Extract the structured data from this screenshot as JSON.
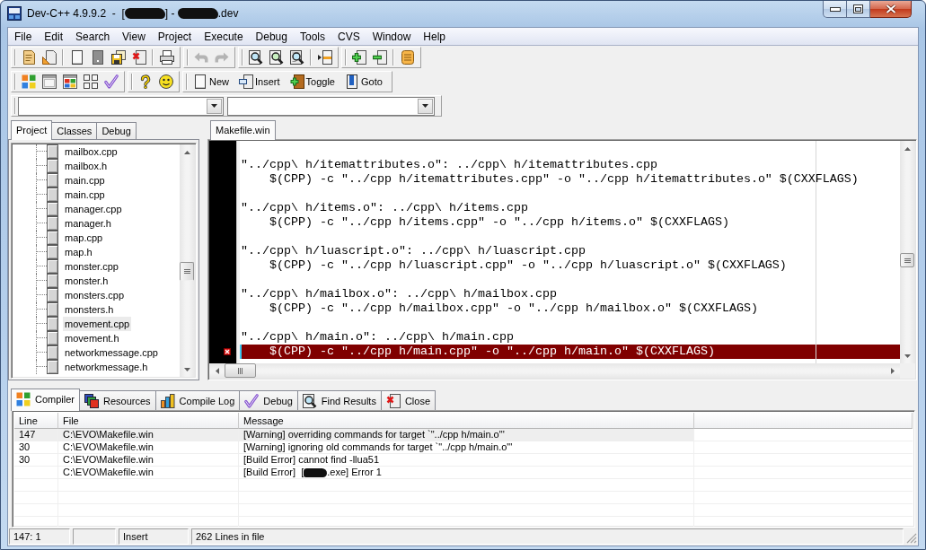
{
  "window": {
    "title": [
      {
        "kind": "text",
        "text": "Dev-C++ 4.9.9.2  -  ["
      },
      {
        "kind": "redacted"
      },
      {
        "kind": "text",
        "text": "] - "
      },
      {
        "kind": "redacted"
      },
      {
        "kind": "text",
        "text": ".dev"
      }
    ]
  },
  "menu": [
    "File",
    "Edit",
    "Search",
    "View",
    "Project",
    "Execute",
    "Debug",
    "Tools",
    "CVS",
    "Window",
    "Help"
  ],
  "toolbars": [
    {
      "groups": [
        {
          "sections": [
            {
              "buttons": [
                {
                  "kind": "project",
                  "disabled": false
                },
                {
                  "kind": "open",
                  "disabled": false
                }
              ]
            },
            {
              "buttons": [
                {
                  "kind": "new",
                  "disabled": false
                },
                {
                  "kind": "blank",
                  "disabled": false
                },
                {
                  "kind": "saveall",
                  "disabled": false
                },
                {
                  "kind": "close",
                  "disabled": false
                }
              ]
            },
            {
              "buttons": [
                {
                  "kind": "print",
                  "disabled": false
                }
              ]
            }
          ]
        },
        {
          "sections": [
            {
              "buttons": [
                {
                  "kind": "undo",
                  "disabled": true
                },
                {
                  "kind": "redo",
                  "disabled": true
                }
              ]
            }
          ]
        },
        {
          "sections": [
            {
              "buttons": [
                {
                  "kind": "find",
                  "disabled": false
                },
                {
                  "kind": "findnext",
                  "disabled": false
                },
                {
                  "kind": "replace",
                  "disabled": false
                }
              ]
            },
            {
              "buttons": [
                {
                  "kind": "gotoline",
                  "disabled": false
                }
              ]
            }
          ]
        },
        {
          "sections": [
            {
              "buttons": [
                {
                  "kind": "add",
                  "disabled": false
                },
                {
                  "kind": "remove",
                  "disabled": false
                }
              ]
            },
            {
              "buttons": [
                {
                  "kind": "note",
                  "disabled": false
                }
              ]
            }
          ]
        }
      ]
    },
    {
      "groups": [
        {
          "sections": [
            {
              "buttons": [
                {
                  "kind": "tiles",
                  "disabled": false
                },
                {
                  "kind": "window",
                  "disabled": false
                },
                {
                  "kind": "colorgrid",
                  "disabled": false
                },
                {
                  "kind": "grid",
                  "disabled": false
                },
                {
                  "kind": "check",
                  "disabled": false
                }
              ]
            }
          ]
        },
        {
          "sections": [
            {
              "buttons": [
                {
                  "kind": "help",
                  "disabled": false
                },
                {
                  "kind": "smiley",
                  "disabled": false
                }
              ]
            }
          ]
        },
        {
          "sections": [
            {
              "buttons": [
                {
                  "kind": "new",
                  "label": "New",
                  "disabled": false
                },
                {
                  "kind": "insert",
                  "label": "Insert",
                  "disabled": false
                },
                {
                  "kind": "toggle",
                  "label": "Toggle",
                  "disabled": false
                },
                {
                  "kind": "goto",
                  "label": "Goto",
                  "disabled": false
                }
              ]
            }
          ]
        }
      ]
    }
  ],
  "left_tabs": [
    {
      "label": "Project",
      "selected": true
    },
    {
      "label": "Classes",
      "selected": false
    },
    {
      "label": "Debug",
      "selected": false
    }
  ],
  "project_tree": {
    "items": [
      {
        "label": "mailbox.cpp",
        "selected": false
      },
      {
        "label": "mailbox.h",
        "selected": false
      },
      {
        "label": "main.cpp",
        "selected": false
      },
      {
        "label": "main.cpp",
        "selected": false
      },
      {
        "label": "manager.cpp",
        "selected": false
      },
      {
        "label": "manager.h",
        "selected": false
      },
      {
        "label": "map.cpp",
        "selected": false
      },
      {
        "label": "map.h",
        "selected": false
      },
      {
        "label": "monster.cpp",
        "selected": false
      },
      {
        "label": "monster.h",
        "selected": false
      },
      {
        "label": "monsters.cpp",
        "selected": false
      },
      {
        "label": "monsters.h",
        "selected": false
      },
      {
        "label": "movement.cpp",
        "selected": true
      },
      {
        "label": "movement.h",
        "selected": false
      },
      {
        "label": "networkmessage.cpp",
        "selected": false
      },
      {
        "label": "networkmessage.h",
        "selected": false
      }
    ]
  },
  "editor": {
    "tabs": [
      {
        "label": "Makefile.win",
        "selected": true
      }
    ],
    "rules": [
      {
        "target": "\"../cpp\\ h/itemattributes.o\": ../cpp\\ h/itemattributes.cpp",
        "command": "$(CPP) -c \"../cpp h/itemattributes.cpp\" -o \"../cpp h/itemattributes.o\" $(CXXFLAGS)",
        "error": false
      },
      {
        "target": "\"../cpp\\ h/items.o\": ../cpp\\ h/items.cpp",
        "command": "$(CPP) -c \"../cpp h/items.cpp\" -o \"../cpp h/items.o\" $(CXXFLAGS)",
        "error": false
      },
      {
        "target": "\"../cpp\\ h/luascript.o\": ../cpp\\ h/luascript.cpp",
        "command": "$(CPP) -c \"../cpp h/luascript.cpp\" -o \"../cpp h/luascript.o\" $(CXXFLAGS)",
        "error": false
      },
      {
        "target": "\"../cpp\\ h/mailbox.o\": ../cpp\\ h/mailbox.cpp",
        "command": "$(CPP) -c \"../cpp h/mailbox.cpp\" -o \"../cpp h/mailbox.o\" $(CXXFLAGS)",
        "error": false
      },
      {
        "target": "\"../cpp\\ h/main.o\": ../cpp\\ h/main.cpp",
        "command": "$(CPP) -c \"../cpp h/main.cpp\" -o \"../cpp h/main.o\" $(CXXFLAGS)",
        "error": true
      }
    ]
  },
  "bottom_tabs": [
    {
      "label": "Compiler",
      "kind": "compiler",
      "selected": true
    },
    {
      "label": "Resources",
      "kind": "resources",
      "selected": false
    },
    {
      "label": "Compile Log",
      "kind": "log",
      "selected": false
    },
    {
      "label": "Debug",
      "kind": "debug",
      "selected": false
    },
    {
      "label": "Find Results",
      "kind": "find",
      "selected": false
    },
    {
      "label": "Close",
      "kind": "close",
      "selected": false
    }
  ],
  "compiler_table": {
    "columns": [
      "Line",
      "File",
      "Message"
    ],
    "rows": [
      {
        "line": "147",
        "file": "C:\\EVO\\Makefile.win",
        "message": [
          {
            "kind": "text",
            "text": "[Warning] overriding commands for target `\"../cpp h/main.o\"'"
          }
        ],
        "selected": true
      },
      {
        "line": "30",
        "file": "C:\\EVO\\Makefile.win",
        "message": [
          {
            "kind": "text",
            "text": "[Warning] ignoring old commands for target `\"../cpp h/main.o\"'"
          }
        ],
        "selected": false
      },
      {
        "line": "30",
        "file": "C:\\EVO\\Makefile.win",
        "message": [
          {
            "kind": "text",
            "text": "[Build Error] cannot find -llua51"
          }
        ],
        "selected": false
      },
      {
        "file": "C:\\EVO\\Makefile.win",
        "message": [
          {
            "kind": "text",
            "text": "[Build Error]  ["
          },
          {
            "kind": "redacted"
          },
          {
            "kind": "text",
            "text": ".exe] Error 1"
          }
        ],
        "selected": false
      }
    ]
  },
  "status_bar": {
    "position": "147: 1",
    "mode": "Insert",
    "info": "262 Lines in file"
  }
}
